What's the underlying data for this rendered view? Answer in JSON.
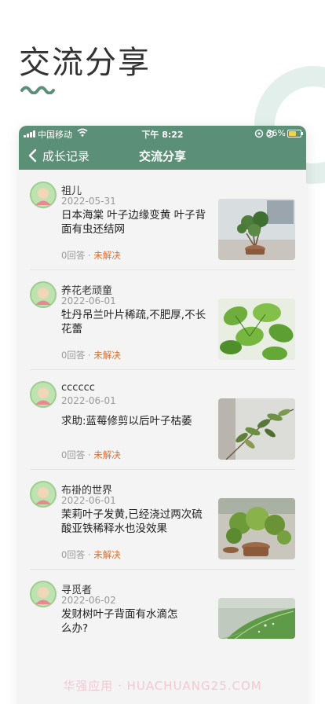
{
  "hero": {
    "title": "交流分享"
  },
  "status_bar": {
    "carrier": "中国移动",
    "time": "下午 8:22",
    "battery": "36%"
  },
  "nav": {
    "back_label": "成长记录",
    "title": "交流分享"
  },
  "posts": [
    {
      "user": "祖儿",
      "date": "2022-05-31",
      "title": "日本海棠 叶子边缘变黄 叶子背面有虫还结网",
      "answers": "0回答",
      "status": "未解决"
    },
    {
      "user": "养花老顽童",
      "date": "2022-06-01",
      "title": "牡丹吊兰叶片稀疏,不肥厚,不长花蕾",
      "answers": "0回答",
      "status": "未解决"
    },
    {
      "user": "cccccc",
      "date": "2022-06-01",
      "title": "求助:蓝莓修剪以后叶子枯萎",
      "answers": "0回答",
      "status": "未解决"
    },
    {
      "user": "布褂的世界",
      "date": "2022-06-01",
      "title": "茉莉叶子发黄,已经浇过两次硫酸亚铁稀释水也没效果",
      "answers": "0回答",
      "status": "未解决"
    },
    {
      "user": "寻觅者",
      "date": "2022-06-02",
      "title": "发财树叶子背面有水滴怎么办?",
      "answers": "",
      "status": ""
    }
  ],
  "watermark": "华强应用 · HUACHUANG25.COM",
  "colors": {
    "brand_green": "#5b8f77",
    "status_orange": "#d9702f",
    "list_bg": "#f4f4f4"
  }
}
